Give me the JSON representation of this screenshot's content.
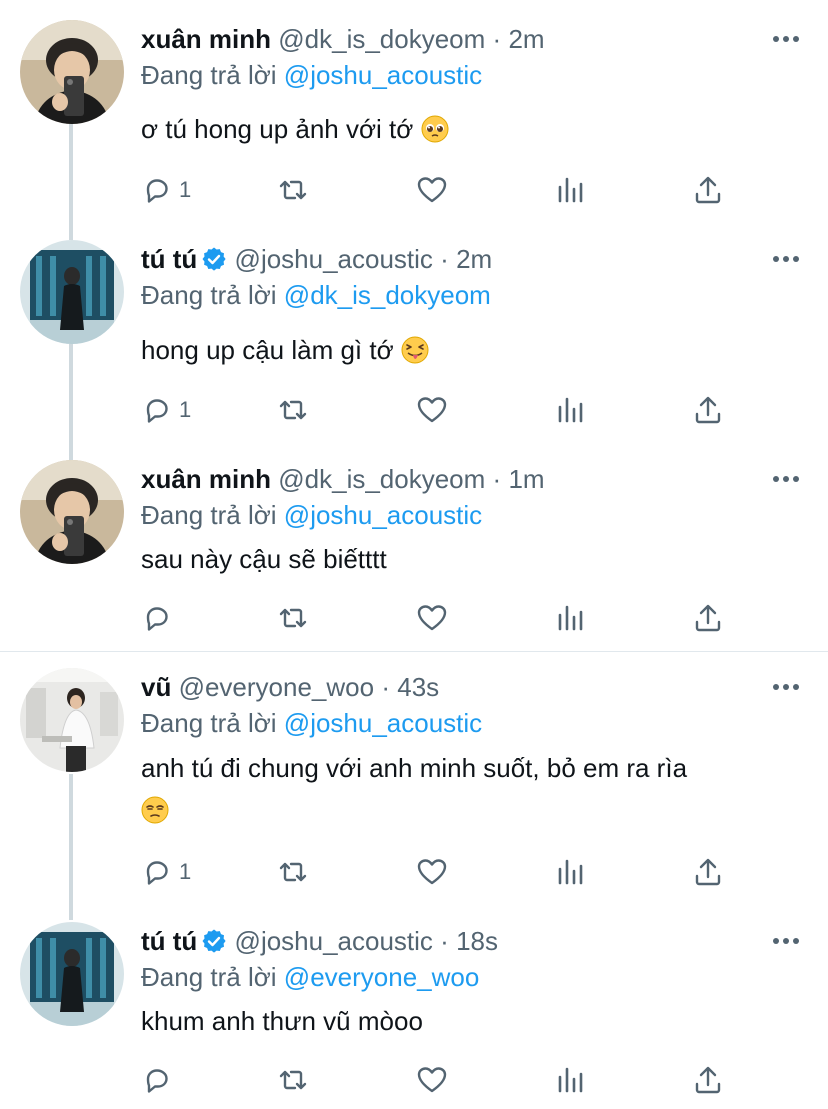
{
  "tweets": [
    {
      "name": "xuân minh",
      "handle": "@dk_is_dokyeom",
      "dot": "·",
      "time": "2m",
      "replying_prefix": "Đang trả lời",
      "replying_to": "@joshu_acoustic",
      "text": "ơ tú hong up ảnh với tớ",
      "emoji": "pleading-face",
      "reply_count": "1",
      "avatar": "xuan-minh"
    },
    {
      "name": "tú tú",
      "handle": "@joshu_acoustic",
      "dot": "·",
      "time": "2m",
      "replying_prefix": "Đang trả lời",
      "replying_to": "@dk_is_dokyeom",
      "text": "hong up cậu làm gì tớ",
      "emoji": "tongue-out-face",
      "reply_count": "1",
      "avatar": "tu-tu",
      "verified": true
    },
    {
      "name": "xuân minh",
      "handle": "@dk_is_dokyeom",
      "dot": "·",
      "time": "1m",
      "replying_prefix": "Đang trả lời",
      "replying_to": "@joshu_acoustic",
      "text": "sau này cậu sẽ biếtttt",
      "reply_count": "",
      "avatar": "xuan-minh"
    },
    {
      "name": "vũ",
      "handle": "@everyone_woo",
      "dot": "·",
      "time": "43s",
      "replying_prefix": "Đang trả lời",
      "replying_to": "@joshu_acoustic",
      "text": "anh tú đi chung với anh minh suốt, bỏ em ra rìa",
      "emoji": "unamused-face",
      "reply_count": "1",
      "avatar": "vu"
    },
    {
      "name": "tú tú",
      "handle": "@joshu_acoustic",
      "dot": "·",
      "time": "18s",
      "replying_prefix": "Đang trả lời",
      "replying_to": "@everyone_woo",
      "text": "khum anh thưn vũ mòoo",
      "reply_count": "",
      "avatar": "tu-tu",
      "verified": true
    }
  ],
  "icons": {
    "reply": "reply-icon",
    "retweet": "retweet-icon",
    "like": "heart-icon",
    "analytics": "analytics-icon",
    "share": "share-icon",
    "more": "more-icon",
    "verified": "verified-badge-icon"
  },
  "colors": {
    "accent": "#1d9bf0",
    "secondary_text": "#536471",
    "primary_text": "#0f1419",
    "thread_line": "#cfd9de"
  }
}
